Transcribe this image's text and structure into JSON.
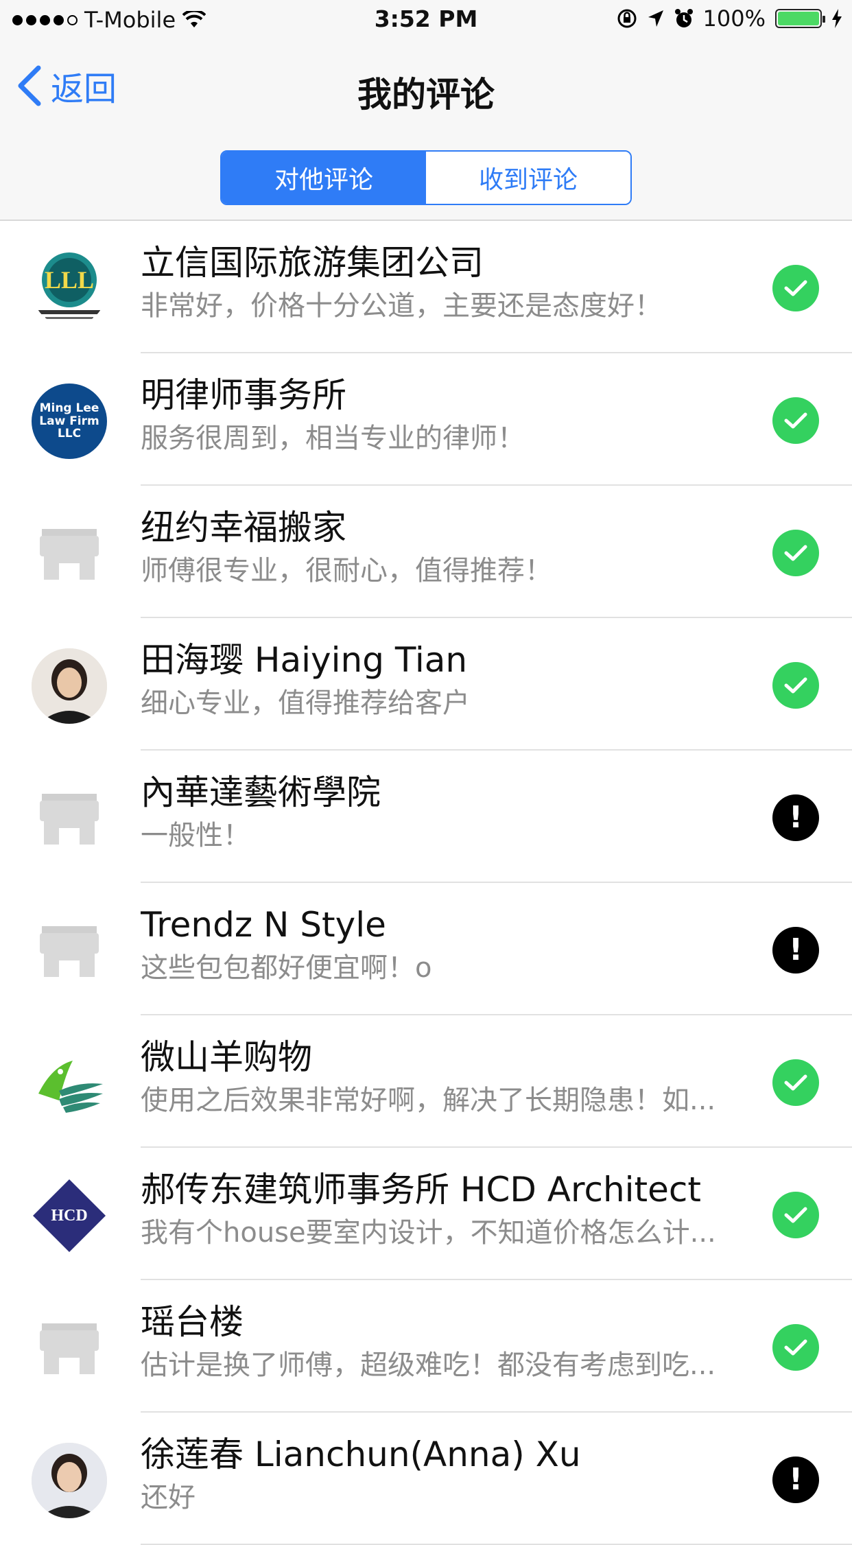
{
  "status_bar": {
    "carrier": "T-Mobile",
    "time": "3:52 PM",
    "battery": "100%",
    "battery_color": "#4cd964"
  },
  "nav": {
    "back_label": "返回",
    "title": "我的评论",
    "tabs": [
      {
        "label": "对他评论",
        "active": true
      },
      {
        "label": "收到评论",
        "active": false
      }
    ]
  },
  "colors": {
    "accent": "#2f7cf6",
    "ok": "#34d15f",
    "warn": "#000000"
  },
  "reviews": [
    {
      "name": "立信国际旅游集团公司",
      "comment": "非常好，价格十分公道，主要还是态度好！",
      "avatar": "lll-logo",
      "status": "check"
    },
    {
      "name": "明律师事务所",
      "comment": "服务很周到，相当专业的律师！",
      "avatar": "ming-lee-law-logo",
      "avatar_text": "Ming Lee Law Firm LLC",
      "status": "check"
    },
    {
      "name": "纽约幸福搬家",
      "comment": "师傅很专业，很耐心，值得推荐！",
      "avatar": "store-placeholder",
      "status": "check"
    },
    {
      "name": "田海璎 Haiying Tian",
      "comment": "细心专业，值得推荐给客户",
      "avatar": "person-photo",
      "status": "check"
    },
    {
      "name": "內華達藝術學院",
      "comment": "一般性！",
      "avatar": "store-placeholder",
      "status": "warning"
    },
    {
      "name": "Trendz N Style",
      "comment": "这些包包都好便宜啊！o",
      "avatar": "store-placeholder",
      "status": "warning"
    },
    {
      "name": "微山羊购物",
      "comment": "使用之后效果非常好啊，解决了长期隐患！如...",
      "avatar": "goat-logo",
      "status": "check"
    },
    {
      "name": "郝传东建筑师事务所 HCD Architect",
      "comment": "我有个house要室内设计，不知道价格怎么计...",
      "avatar": "hcd-logo",
      "avatar_text": "HCD",
      "status": "check"
    },
    {
      "name": "瑶台楼",
      "comment": "估计是换了师傅，超级难吃！都没有考虑到吃...",
      "avatar": "store-placeholder",
      "status": "check"
    },
    {
      "name": "徐莲春 Lianchun(Anna) Xu",
      "comment": "还好",
      "avatar": "person-photo",
      "status": "warning"
    }
  ]
}
